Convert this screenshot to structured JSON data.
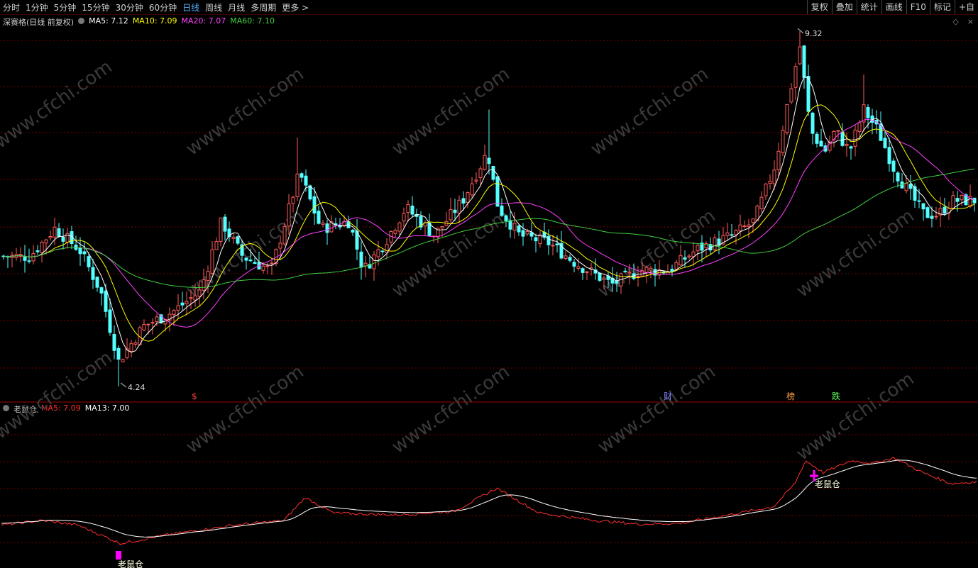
{
  "toolbar": {
    "periods": [
      "分时",
      "1分钟",
      "5分钟",
      "15分钟",
      "30分钟",
      "60分钟",
      "日线",
      "周线",
      "月线",
      "多周期",
      "更多 >"
    ],
    "active_period": "日线",
    "tools": [
      "复权",
      "叠加",
      "统计",
      "画线",
      "F10",
      "标记",
      "+自"
    ]
  },
  "main_info": {
    "stock": "深赛格(日线 前复权)",
    "ma5": "MA5: 7.12",
    "ma10": "MA10: 7.09",
    "ma20": "MA20: 7.07",
    "ma60": "MA60: 7.10"
  },
  "right_icons": [
    "◇",
    "×"
  ],
  "indicator_info": {
    "name": "老鼠仓",
    "ma5": "MA5: 7.09",
    "ma13": "MA13: 7.00"
  },
  "colors": {
    "up": "#ff5a5a",
    "down": "#54ffff",
    "ma5": "#ffffff",
    "ma10": "#ffff00",
    "ma20": "#ff40ff",
    "ma60": "#40d040",
    "indicator_ma5": "#ff3030",
    "indicator_ma13": "#ffffff",
    "grid": "#7a0000",
    "marker": "#ff00ff"
  },
  "chart_data": {
    "type": "candlestick",
    "high_label": "9.32",
    "low_label": "4.24",
    "event_markers": [
      "$",
      "财",
      "榜",
      "跌"
    ],
    "indicator_signal_labels": [
      "老鼠仓",
      "老鼠仓"
    ],
    "watermark": "www.cfchi.com"
  }
}
